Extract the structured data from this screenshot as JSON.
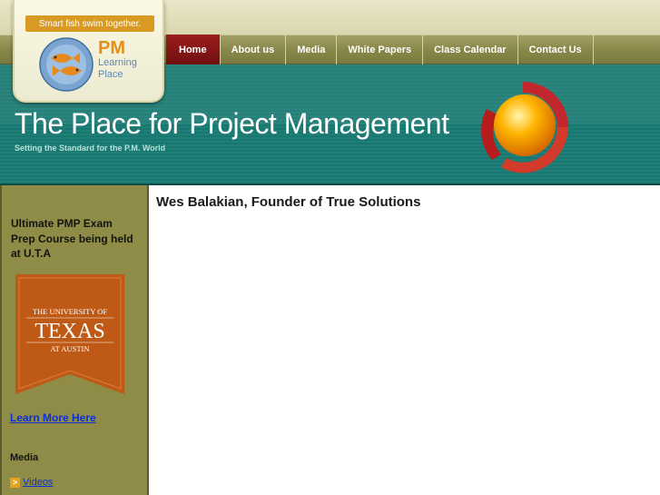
{
  "logo": {
    "tagline": "Smart fish swim together.",
    "pm": "PM",
    "sub": "Learning Place"
  },
  "nav": {
    "items": [
      {
        "label": "Home",
        "active": true
      },
      {
        "label": "About us"
      },
      {
        "label": "Media"
      },
      {
        "label": "White Papers"
      },
      {
        "label": "Class Calendar"
      },
      {
        "label": "Contact Us"
      }
    ]
  },
  "banner": {
    "title": "The Place for Project Management",
    "subtitle": "Setting the Standard for the P.M. World"
  },
  "sidebar": {
    "heading": "Ultimate PMP Exam Prep Course being held at U.T.A",
    "ut_line1": "THE UNIVERSITY OF",
    "ut_line2": "TEXAS",
    "ut_line3": "AT AUSTIN",
    "learn_more": "Learn More Here",
    "media": "Media",
    "videos": "Videos"
  },
  "main": {
    "title": "Wes Balakian, Founder of True Solutions"
  },
  "colors": {
    "nav_active": "#8a1717",
    "banner_teal": "#1d7f77",
    "sidebar_olive": "#8e8c47",
    "ut_orange": "#bf5a16",
    "link_blue": "#0d2fd6"
  }
}
